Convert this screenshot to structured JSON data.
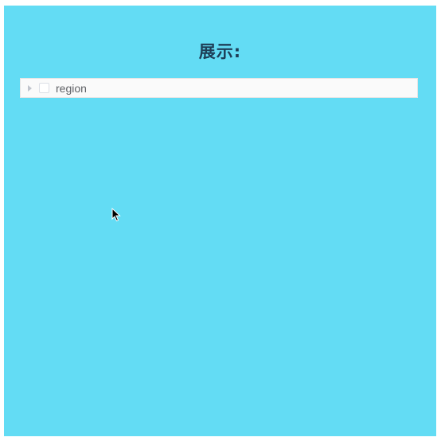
{
  "page": {
    "title": "展示:"
  },
  "tree": {
    "nodes": [
      {
        "label": "region",
        "expanded": false,
        "checked": false
      }
    ]
  },
  "colors": {
    "background": "#63dcf4",
    "title": "#1e3e57",
    "tree_background": "#fafafa",
    "label_text": "#606266"
  },
  "icons": {
    "expander": "caret-right-icon",
    "cursor": "mouse-cursor-icon"
  }
}
